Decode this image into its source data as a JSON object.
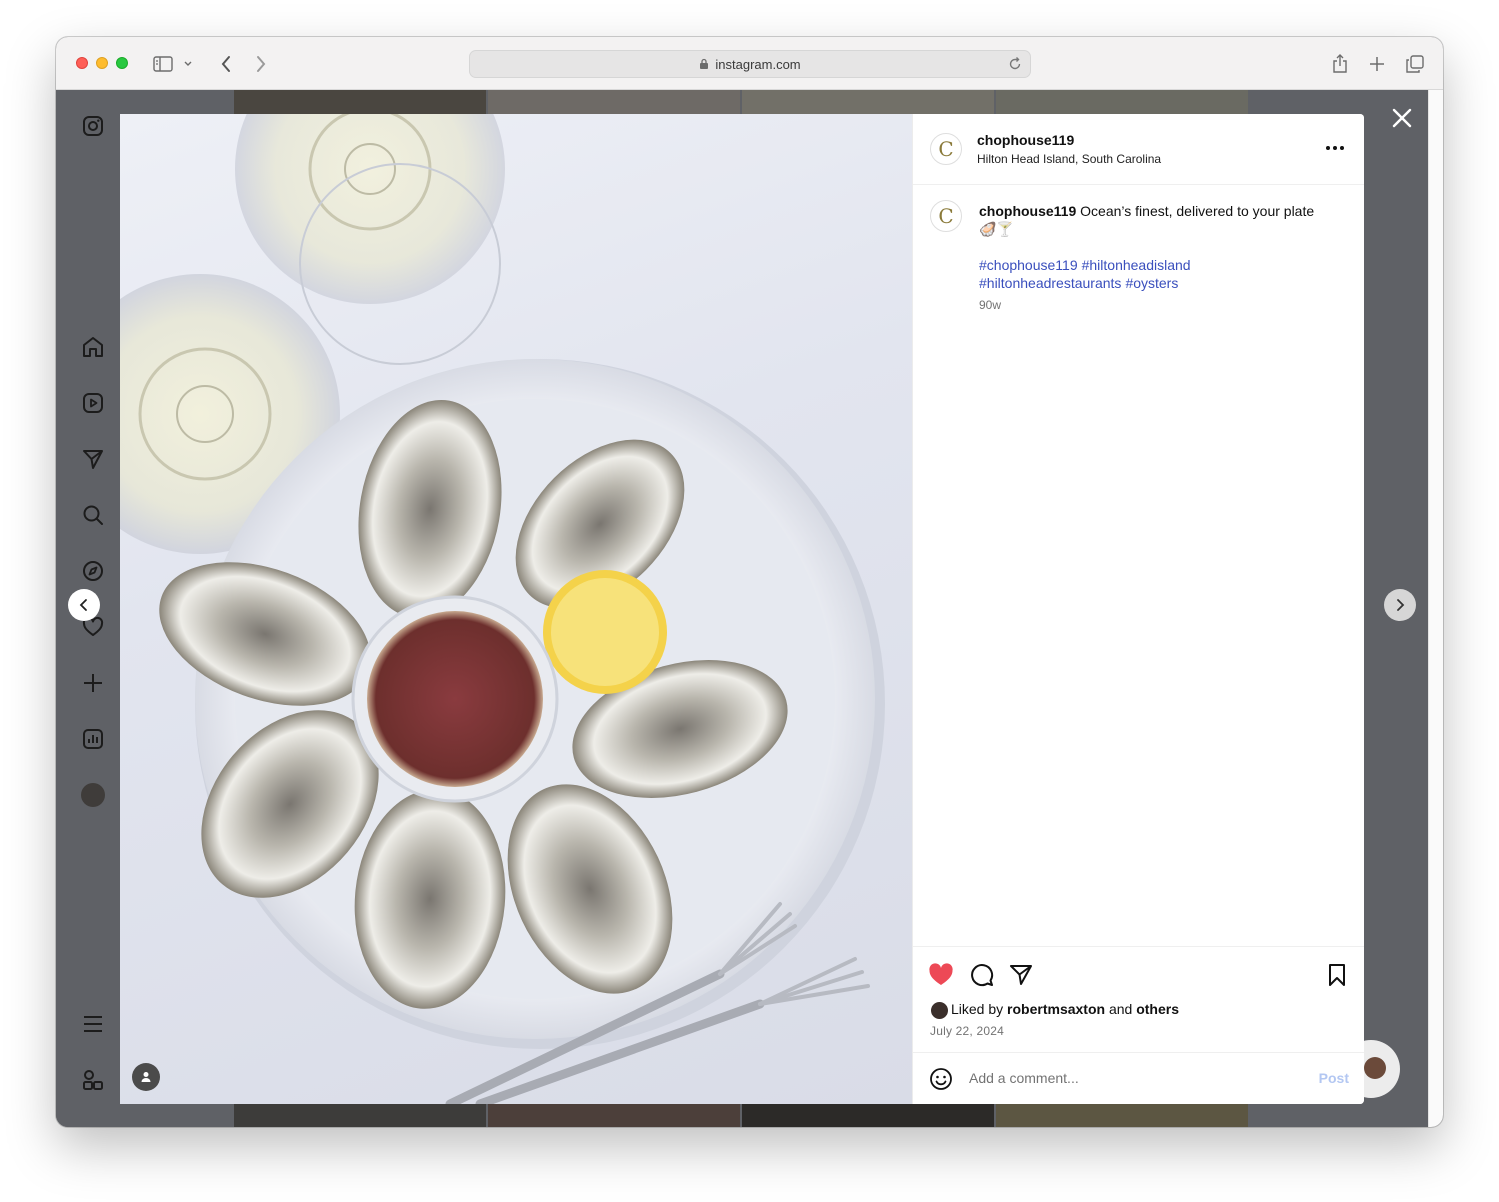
{
  "browser": {
    "url": "instagram.com"
  },
  "post": {
    "username": "chophouse119",
    "location": "Hilton Head Island, South Carolina",
    "avatar_letter": "C",
    "caption_user": "chophouse119",
    "caption_text": "Ocean’s finest, delivered to your plate",
    "caption_emoji": "🦪🍸",
    "hashtags": [
      "#chophouse119",
      "#hiltonheadisland",
      "#hiltonheadrestaurants",
      "#oysters"
    ],
    "time_ago": "90w",
    "liked_by_prefix": "Liked by",
    "liked_by_user": "robertmsaxton",
    "liked_by_and": "and",
    "liked_by_others": "others",
    "date": "July 22, 2024",
    "comment_placeholder": "Add a comment...",
    "post_label": "Post"
  },
  "colors": {
    "heart": "#ed4956",
    "hashtag": "#3a4fbd",
    "post_disabled": "#b3c7f2"
  }
}
